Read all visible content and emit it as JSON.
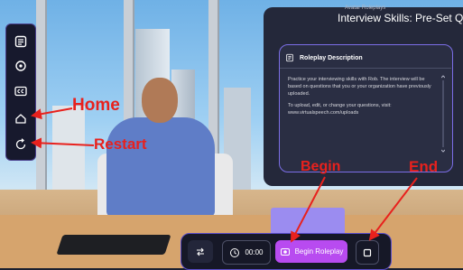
{
  "panel": {
    "subtitle": "Avatar Roleplays",
    "title": "Interview Skills: Pre-Set Qu",
    "card": {
      "heading": "Roleplay Description",
      "paragraph1": "Practice your interviewing skills with Rob. The interview will be based on questions that you or your organization have previously uploaded.",
      "paragraph2": "To upload, edit, or change your questions, visit: www.virtualspeech.com/uploads"
    }
  },
  "bottombar": {
    "timer": "00:00",
    "begin_label": "Begin Roleplay"
  },
  "annotations": {
    "home": "Home",
    "restart": "Restart",
    "begin": "Begin",
    "end": "End"
  },
  "colors": {
    "accent": "#b84bf0",
    "annotation": "#e8211d",
    "panel_bg": "#24283a"
  },
  "icons": {
    "sidebar": [
      "notes-icon",
      "settings-icon",
      "captions-icon",
      "home-icon",
      "restart-icon"
    ],
    "bottombar": [
      "swap-icon",
      "clock-icon",
      "record-icon",
      "stop-icon"
    ]
  }
}
